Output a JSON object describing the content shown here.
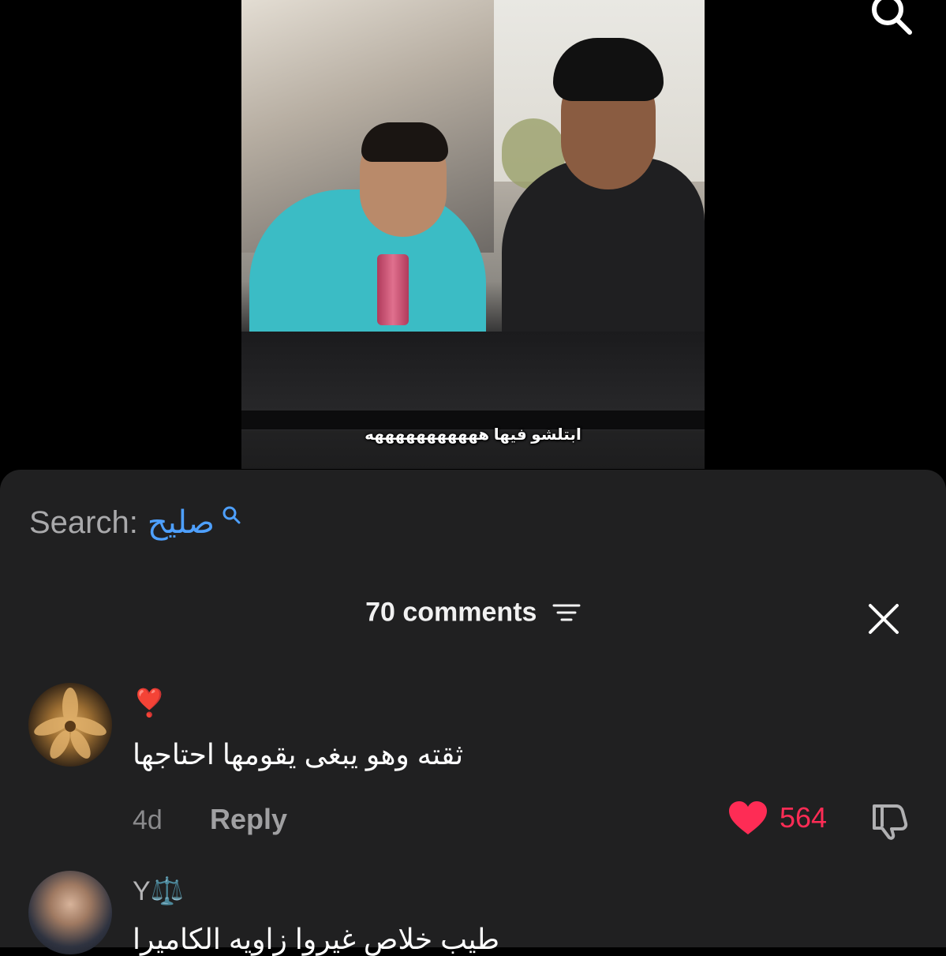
{
  "video": {
    "subtitle": "ابتلشو فيها هههههههههههه"
  },
  "sheet": {
    "search_label": "Search:",
    "search_term": "صليح",
    "comments_count": "70 comments"
  },
  "comments": [
    {
      "username": "❣️",
      "text": "ثقته وهو يبغى يقومها احتاجها",
      "age": "4d",
      "reply_label": "Reply",
      "likes": "564"
    },
    {
      "username": "Y⚖️",
      "text": "طيب خلاص غيروا زاويه الكاميرا"
    }
  ],
  "colors": {
    "sheet_bg": "#202021",
    "link_blue": "#4ea0ff",
    "like_red": "#fe2c55"
  },
  "icons": [
    "search-icon",
    "sort-icon",
    "close-icon",
    "heart-icon",
    "dislike-icon"
  ]
}
